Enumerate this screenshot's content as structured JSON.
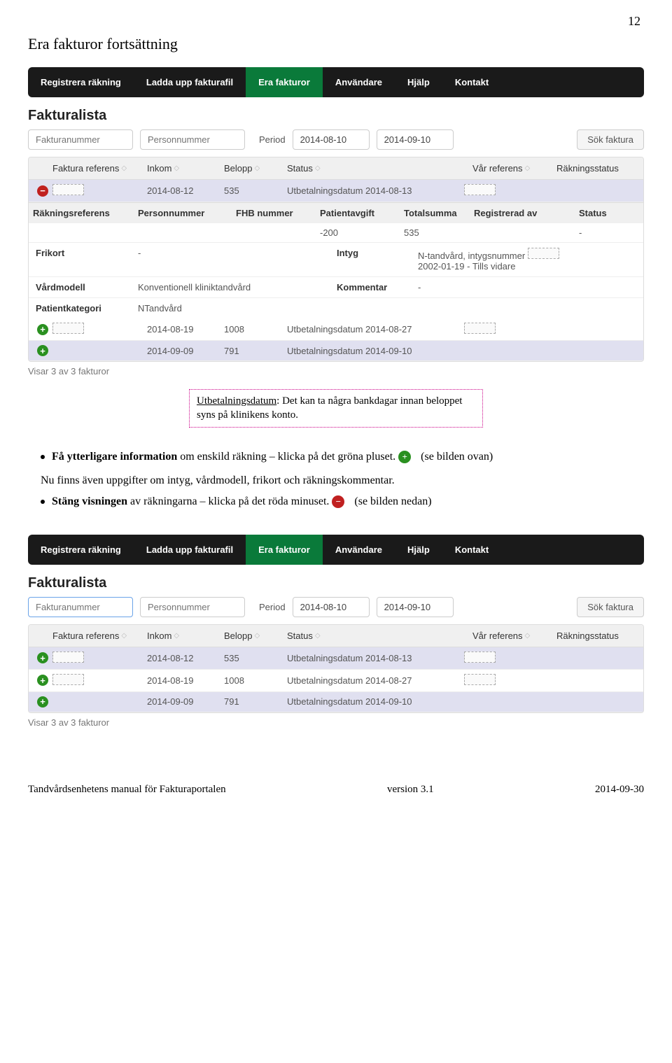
{
  "page_number": "12",
  "page_title": "Era fakturor fortsättning",
  "nav": {
    "items": [
      "Registrera räkning",
      "Ladda upp fakturafil",
      "Era fakturor",
      "Användare",
      "Hjälp",
      "Kontakt"
    ],
    "active": 2
  },
  "section_title": "Fakturalista",
  "filters": {
    "fnr_placeholder": "Fakturanummer",
    "pnr_placeholder": "Personnummer",
    "period_label": "Period",
    "date_from": "2014-08-10",
    "date_to": "2014-09-10",
    "search_btn": "Sök faktura"
  },
  "columns": {
    "ref": "Faktura referens",
    "inkom": "Inkom",
    "belopp": "Belopp",
    "status": "Status",
    "varref": "Vår referens",
    "rakstatus": "Räkningsstatus"
  },
  "rows_top": [
    {
      "inkom": "2014-08-12",
      "belopp": "535",
      "status": "Utbetalningsdatum 2014-08-13"
    },
    {
      "inkom": "2014-08-19",
      "belopp": "1008",
      "status": "Utbetalningsdatum 2014-08-27"
    },
    {
      "inkom": "2014-09-09",
      "belopp": "791",
      "status": "Utbetalningsdatum 2014-09-10"
    }
  ],
  "detail": {
    "head": {
      "rakref": "Räkningsreferens",
      "pnr": "Personnummer",
      "fhb": "FHB nummer",
      "patavg": "Patientavgift",
      "total": "Totalsumma",
      "regav": "Registrerad av",
      "status": "Status"
    },
    "row": {
      "patavg": "-200",
      "total": "535",
      "status": "-"
    },
    "kv": {
      "frikort_k": "Frikort",
      "frikort_v": "-",
      "intyg_k": "Intyg",
      "intyg_v1": "N-tandvård, intygsnummer",
      "intyg_v2": "2002-01-19 - Tills vidare",
      "vardmodell_k": "Vårdmodell",
      "vardmodell_v": "Konventionell kliniktandvård",
      "kommentar_k": "Kommentar",
      "kommentar_v": "-",
      "patkat_k": "Patientkategori",
      "patkat_v": "NTandvård"
    }
  },
  "footer_count": "Visar 3 av 3 fakturor",
  "caption": {
    "l1": "Utbetalningsdatum",
    "l2": ": Det kan ta några bankdagar innan beloppet syns på klinikens konto."
  },
  "body": {
    "b1a": "Få ytterligare information",
    "b1b": " om enskild räkning – klicka på det gröna pluset. ",
    "b1c": "(se bilden ovan)",
    "b2": "Nu finns även uppgifter om intyg, vårdmodell, frikort och räkningskommentar.",
    "b3a": "Stäng visningen",
    "b3b": " av räkningarna – klicka på det röda minuset. ",
    "b3c": "(se bilden nedan)"
  },
  "page_footer": {
    "left": "Tandvårdsenhetens manual för Fakturaportalen",
    "mid": "version 3.1",
    "right": "2014-09-30"
  }
}
